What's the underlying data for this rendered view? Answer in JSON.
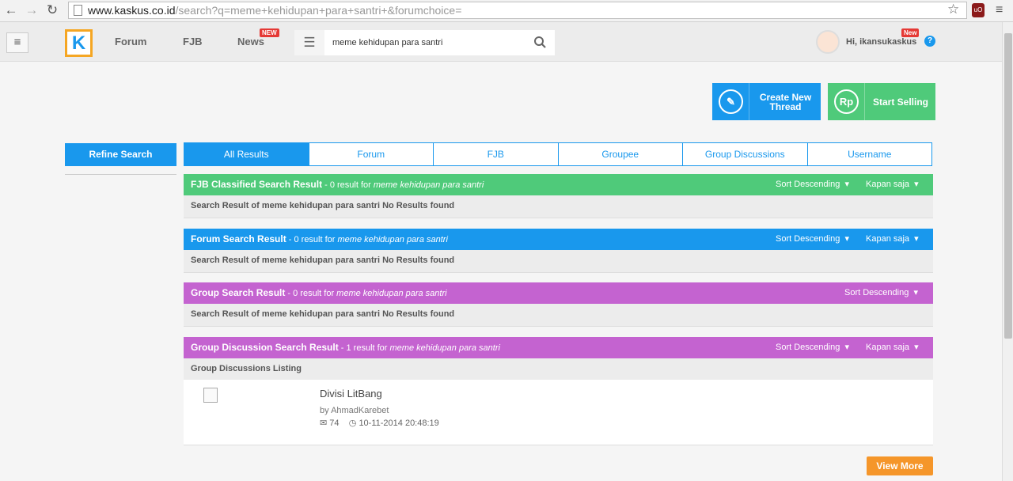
{
  "browser": {
    "url_host": "www.kaskus.co.id",
    "url_path": "/search?q=meme+kehidupan+para+santri+&forumchoice="
  },
  "header": {
    "nav": [
      {
        "label": "Forum"
      },
      {
        "label": "FJB"
      },
      {
        "label": "News",
        "badge": "NEW"
      }
    ],
    "search_value": "meme kehidupan para santri",
    "user_greeting": "Hi, ikansukaskus",
    "user_badge": "New",
    "help": "?"
  },
  "actions": {
    "create_thread": "Create New Thread",
    "start_selling": "Start Selling",
    "rp": "Rp"
  },
  "sidebar": {
    "refine_label": "Refine Search"
  },
  "tabs": [
    "All Results",
    "Forum",
    "FJB",
    "Groupee",
    "Group Discussions",
    "Username"
  ],
  "sections": [
    {
      "title": "FJB Classified Search Result",
      "count_text": " - 0 result for ",
      "query": "meme kehidupan para santri",
      "sort": "Sort Descending",
      "time": "Kapan saja",
      "body": "Search Result of meme kehidupan para santri No Results found",
      "color": "#4fca7a"
    },
    {
      "title": "Forum Search Result",
      "count_text": " - 0 result for ",
      "query": "meme kehidupan para santri",
      "sort": "Sort Descending",
      "time": "Kapan saja",
      "body": "Search Result of meme kehidupan para santri No Results found",
      "color": "#1998ed"
    },
    {
      "title": "Group Search Result",
      "count_text": " - 0 result for ",
      "query": "meme kehidupan para santri",
      "sort": "Sort Descending",
      "body": "Search Result of meme kehidupan para santri No Results found",
      "color": "#c463d0"
    },
    {
      "title": "Group Discussion Search Result",
      "count_text": " - 1 result for ",
      "query": "meme kehidupan para santri",
      "sort": "Sort Descending",
      "time": "Kapan saja",
      "body": "Group Discussions Listing",
      "color": "#c463d0"
    }
  ],
  "listing": {
    "title": "Divisi LitBang",
    "author": "by AhmadKarebet",
    "replies": "74",
    "datetime": "10-11-2014 20:48:19"
  },
  "view_more": "View More"
}
